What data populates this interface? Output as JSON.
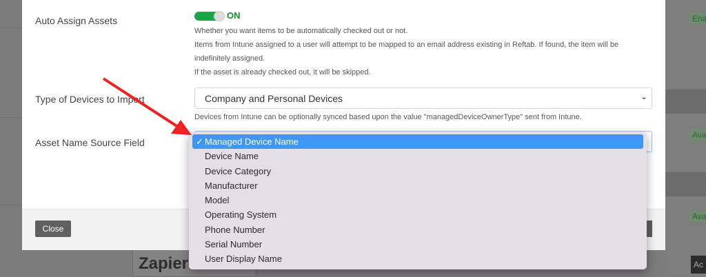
{
  "background": {
    "badges": [
      "Ena",
      "Ava",
      "Ava"
    ],
    "button": "Ac",
    "heading": "Zapier"
  },
  "modal": {
    "auto_assign": {
      "label": "Auto Assign Assets",
      "toggle_state": "ON",
      "toggle_on": true,
      "help": [
        "Whether you want items to be automatically checked out or not.",
        "Items from Intune assigned to a user will attempt to be mapped to an email address existing in Reftab. If found, the item will be indefinitely assigned.",
        "If the asset is already checked out, it will be skipped."
      ]
    },
    "device_type": {
      "label": "Type of Devices to Import",
      "value": "Company and Personal Devices",
      "help": "Devices from Intune can be optionally synced based upon the value \"managedDeviceOwnerType\" sent from Intune."
    },
    "name_source": {
      "label": "Asset Name Source Field",
      "selected": "Managed Device Name",
      "options": [
        "Managed Device Name",
        "Device Name",
        "Device Category",
        "Manufacturer",
        "Model",
        "Operating System",
        "Phone Number",
        "Serial Number",
        "User Display Name"
      ]
    },
    "footer": {
      "close_label": "Close"
    }
  },
  "colors": {
    "accent": "#3d97f5",
    "toggle": "#1fa34a",
    "arrow": "#ee2222"
  },
  "icons": {
    "check": "✓",
    "chevron": "⌄"
  }
}
